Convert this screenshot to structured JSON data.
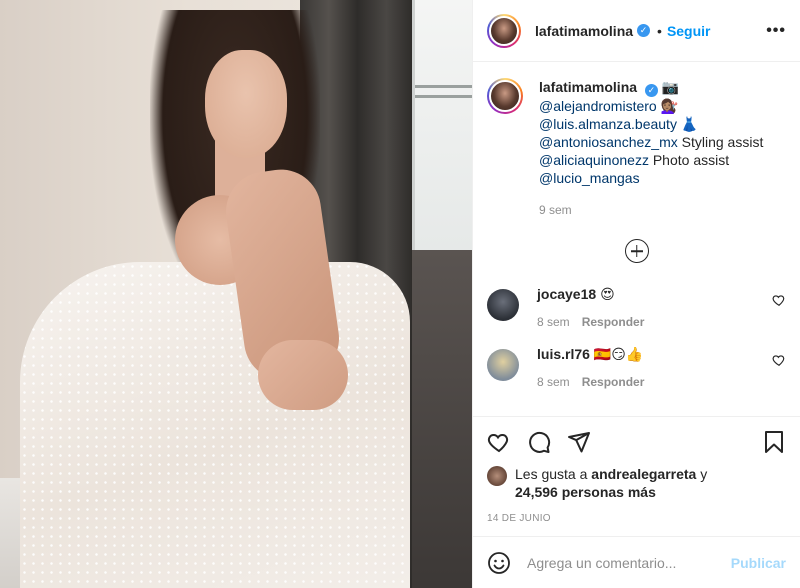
{
  "post": {
    "image_alt": "Mujer con vestido blanco sentada junto a una ventana"
  },
  "header": {
    "username": "lafatimamolina",
    "verified_glyph": "✓",
    "separator": "•",
    "follow_label": "Seguir",
    "more_label": "•••"
  },
  "caption": {
    "username": "lafatimamolina",
    "emoji_camera": "📷",
    "lines": [
      {
        "mention": "@alejandromistero",
        "text": " 💇🏽‍♀️"
      },
      {
        "mention": "@luis.almanza.beauty",
        "text": " 👗"
      },
      {
        "mention": "@antoniosanchez_mx",
        "text": " Styling assist"
      },
      {
        "mention": "@aliciaquinonezz",
        "text": " Photo assist"
      },
      {
        "mention": "@lucio_mangas",
        "text": ""
      }
    ],
    "time": "9 sem"
  },
  "comments": [
    {
      "username": "jocaye18",
      "text": "😍",
      "time": "8 sem",
      "reply": "Responder"
    },
    {
      "username": "luis.rl76",
      "text": "🇪🇸😏👍",
      "time": "8 sem",
      "reply": "Responder"
    }
  ],
  "likes": {
    "prefix": "Les gusta a ",
    "user": "andrealegarreta",
    "middle": " y",
    "count": "24,596 personas más"
  },
  "date": "14 DE JUNIO",
  "composer": {
    "placeholder": "Agrega un comentario...",
    "publish_label": "Publicar"
  },
  "icons": {
    "like": "heart-icon",
    "comment": "comment-icon",
    "share": "share-icon",
    "save": "bookmark-icon",
    "emoji": "emoji-icon",
    "load_more": "plus-circle-icon"
  },
  "colors": {
    "link": "#0095f6",
    "mention": "#00376b",
    "muted": "#8e8e8e",
    "verified": "#3897f0"
  }
}
